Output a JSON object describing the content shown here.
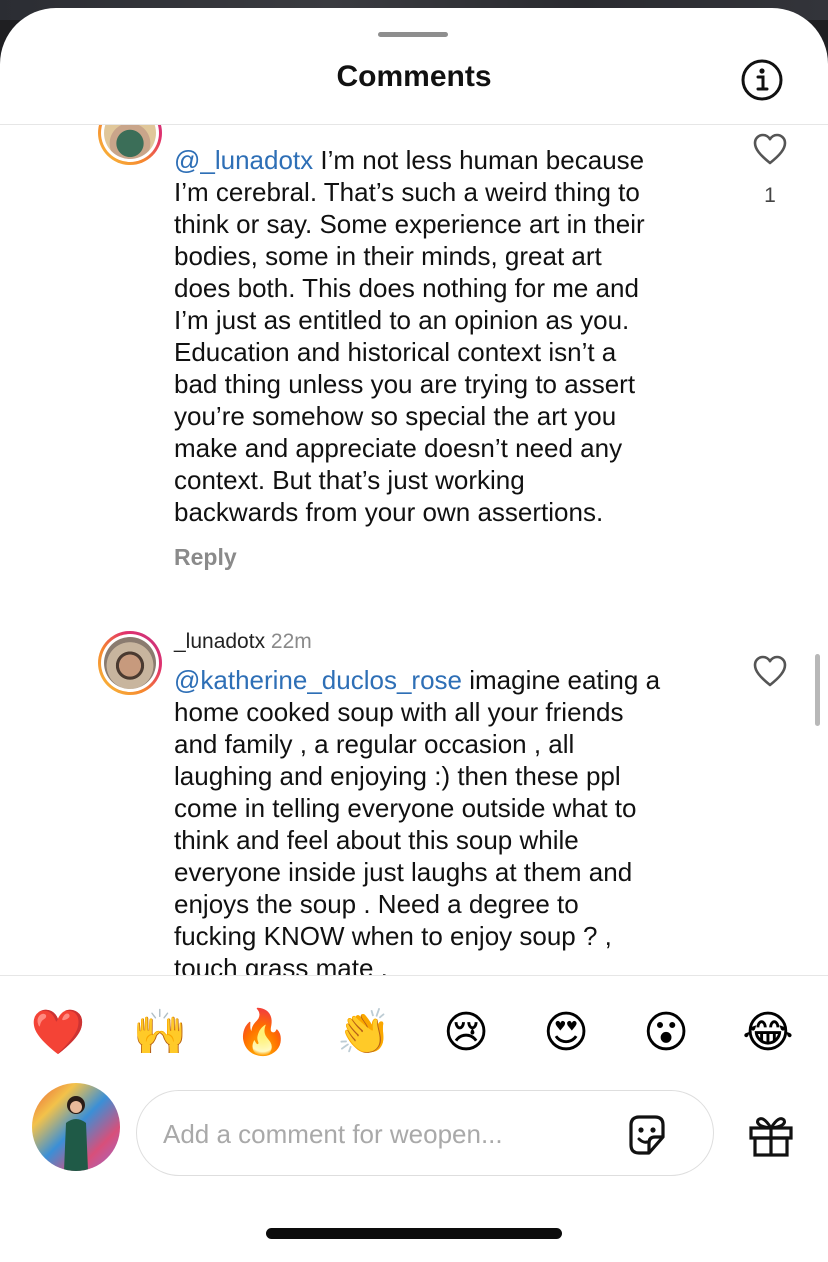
{
  "header": {
    "title": "Comments",
    "info_icon": "info-circle-icon"
  },
  "comments": [
    {
      "mention": "@_lunadotx",
      "text": " I’m not less human because\nI’m cerebral. That’s such a weird thing to\nthink or say. Some experience art in their\nbodies, some in their minds, great art\ndoes both. This does nothing for me and\nI’m just as entitled to an opinion as you.\nEducation and historical context isn’t a\nbad thing unless you are trying to assert\nyou’re somehow so special the art you\nmake and appreciate doesn’t need any\ncontext. But that’s just working\nbackwards from your own assertions.",
      "reply_label": "Reply",
      "like_count": "1"
    },
    {
      "username": "_lunadotx",
      "time": "22m",
      "mention": "@katherine_duclos_rose",
      "text": " imagine eating a\nhome cooked soup with all your friends\nand family , a regular occasion , all\nlaughing and enjoying :) then these ppl\ncome in telling everyone outside what to\nthink and feel about this soup while\neveryone inside just laughs at them and\nenjoys the soup . Need a degree to\nfucking KNOW when to enjoy soup ? ,\ntouch grass mate ."
    }
  ],
  "reactions": [
    "❤️",
    "🙌",
    "🔥",
    "👏",
    "😢",
    "😍",
    "😮",
    "😂"
  ],
  "composer": {
    "placeholder": "Add a comment for weopen...",
    "sticker_icon": "sticker-icon",
    "gift_icon": "gift-icon"
  }
}
